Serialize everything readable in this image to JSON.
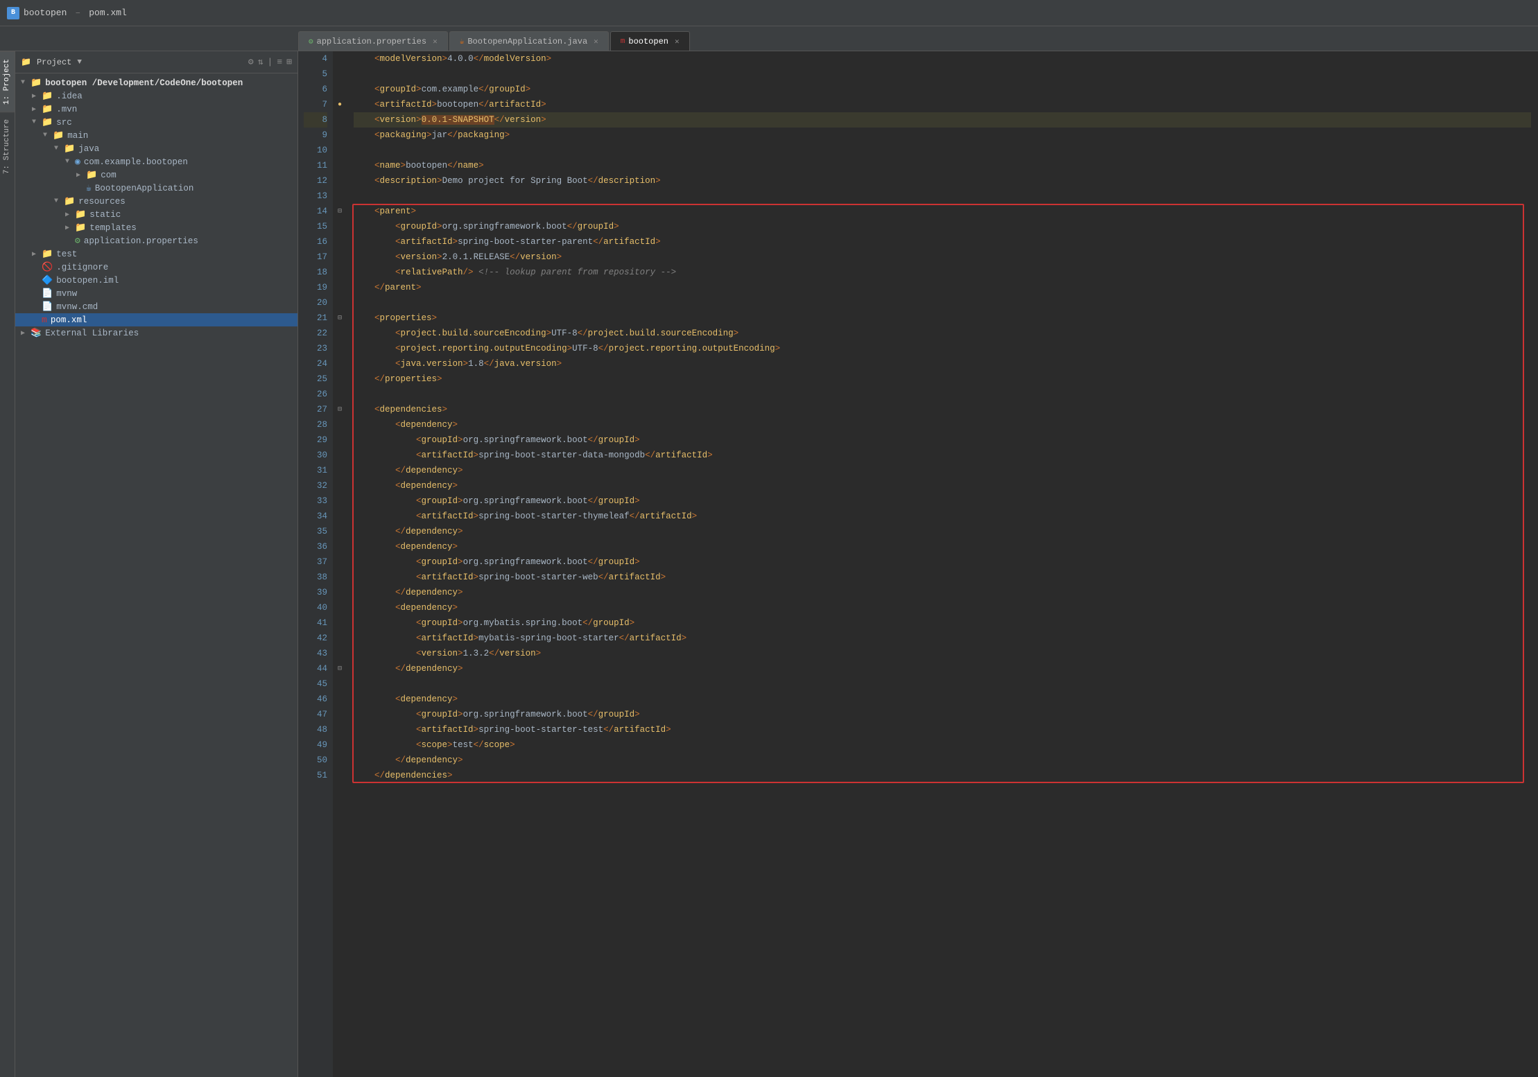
{
  "titleBar": {
    "appName": "bootopen",
    "fileName": "pom.xml",
    "logoText": "bootopen"
  },
  "tabs": [
    {
      "id": "application-properties",
      "label": "application.properties",
      "type": "props",
      "active": false
    },
    {
      "id": "bootopen-application",
      "label": "BootopenApplication.java",
      "type": "java",
      "active": false
    },
    {
      "id": "bootopen-pom",
      "label": "bootopen",
      "type": "maven",
      "active": true
    }
  ],
  "projectPanel": {
    "header": "Project",
    "dropdown": "Project"
  },
  "tree": [
    {
      "level": 0,
      "label": "bootopen /Development/CodeOne/bootopen",
      "type": "root",
      "expanded": true,
      "selected": false
    },
    {
      "level": 1,
      "label": ".idea",
      "type": "folder",
      "expanded": false,
      "selected": false
    },
    {
      "level": 1,
      "label": ".mvn",
      "type": "folder",
      "expanded": false,
      "selected": false
    },
    {
      "level": 1,
      "label": "src",
      "type": "folder",
      "expanded": true,
      "selected": false
    },
    {
      "level": 2,
      "label": "main",
      "type": "folder",
      "expanded": true,
      "selected": false
    },
    {
      "level": 3,
      "label": "java",
      "type": "folder",
      "expanded": true,
      "selected": false
    },
    {
      "level": 4,
      "label": "com.example.bootopen",
      "type": "package",
      "expanded": true,
      "selected": false
    },
    {
      "level": 5,
      "label": "com",
      "type": "folder",
      "expanded": false,
      "selected": false
    },
    {
      "level": 5,
      "label": "BootopenApplication",
      "type": "java",
      "expanded": false,
      "selected": false
    },
    {
      "level": 3,
      "label": "resources",
      "type": "folder",
      "expanded": true,
      "selected": false
    },
    {
      "level": 4,
      "label": "static",
      "type": "folder",
      "expanded": false,
      "selected": false
    },
    {
      "level": 4,
      "label": "templates",
      "type": "folder",
      "expanded": false,
      "selected": false
    },
    {
      "level": 4,
      "label": "application.properties",
      "type": "props",
      "expanded": false,
      "selected": false
    },
    {
      "level": 1,
      "label": "test",
      "type": "folder",
      "expanded": false,
      "selected": false
    },
    {
      "level": 1,
      "label": ".gitignore",
      "type": "gitignore",
      "expanded": false,
      "selected": false
    },
    {
      "level": 1,
      "label": "bootopen.iml",
      "type": "iml",
      "expanded": false,
      "selected": false
    },
    {
      "level": 1,
      "label": "mvnw",
      "type": "mvnw",
      "expanded": false,
      "selected": false
    },
    {
      "level": 1,
      "label": "mvnw.cmd",
      "type": "mvnw",
      "expanded": false,
      "selected": false
    },
    {
      "level": 1,
      "label": "pom.xml",
      "type": "xml",
      "expanded": false,
      "selected": true
    }
  ],
  "externalLibraries": {
    "label": "External Libraries",
    "expanded": false
  },
  "code": {
    "lines": [
      {
        "num": 4,
        "content": "    <modelVersion>4.0.0</modelVersion>",
        "type": "xml",
        "gutterIcon": ""
      },
      {
        "num": 5,
        "content": "",
        "type": "empty",
        "gutterIcon": ""
      },
      {
        "num": 6,
        "content": "    <groupId>com.example</groupId>",
        "type": "xml",
        "gutterIcon": ""
      },
      {
        "num": 7,
        "content": "    <artifactId>bootopen</artifactId>",
        "type": "xml",
        "gutterIcon": "yellow-dot"
      },
      {
        "num": 8,
        "content": "    <version>0.0.1-SNAPSHOT</version>",
        "type": "xml-highlight",
        "gutterIcon": ""
      },
      {
        "num": 9,
        "content": "    <packaging>jar</packaging>",
        "type": "xml",
        "gutterIcon": ""
      },
      {
        "num": 10,
        "content": "",
        "type": "empty",
        "gutterIcon": ""
      },
      {
        "num": 11,
        "content": "    <name>bootopen</name>",
        "type": "xml",
        "gutterIcon": ""
      },
      {
        "num": 12,
        "content": "    <description>Demo project for Spring Boot</description>",
        "type": "xml",
        "gutterIcon": ""
      },
      {
        "num": 13,
        "content": "",
        "type": "empty",
        "gutterIcon": ""
      },
      {
        "num": 14,
        "content": "    <parent>",
        "type": "xml-section-start",
        "gutterIcon": "fold"
      },
      {
        "num": 15,
        "content": "        <groupId>org.springframework.boot</groupId>",
        "type": "xml",
        "gutterIcon": ""
      },
      {
        "num": 16,
        "content": "        <artifactId>spring-boot-starter-parent</artifactId>",
        "type": "xml",
        "gutterIcon": ""
      },
      {
        "num": 17,
        "content": "        <version>2.0.1.RELEASE</version>",
        "type": "xml",
        "gutterIcon": ""
      },
      {
        "num": 18,
        "content": "        <relativePath/> <!-- lookup parent from repository -->",
        "type": "xml-comment",
        "gutterIcon": ""
      },
      {
        "num": 19,
        "content": "    </parent>",
        "type": "xml",
        "gutterIcon": ""
      },
      {
        "num": 20,
        "content": "",
        "type": "empty",
        "gutterIcon": ""
      },
      {
        "num": 21,
        "content": "    <properties>",
        "type": "xml-section-start",
        "gutterIcon": "fold"
      },
      {
        "num": 22,
        "content": "        <project.build.sourceEncoding>UTF-8</project.build.sourceEncoding>",
        "type": "xml",
        "gutterIcon": ""
      },
      {
        "num": 23,
        "content": "        <project.reporting.outputEncoding>UTF-8</project.reporting.outputEncoding>",
        "type": "xml",
        "gutterIcon": ""
      },
      {
        "num": 24,
        "content": "        <java.version>1.8</java.version>",
        "type": "xml",
        "gutterIcon": ""
      },
      {
        "num": 25,
        "content": "    </properties>",
        "type": "xml",
        "gutterIcon": ""
      },
      {
        "num": 26,
        "content": "",
        "type": "empty",
        "gutterIcon": ""
      },
      {
        "num": 27,
        "content": "    <dependencies>",
        "type": "xml-section-start",
        "gutterIcon": "fold"
      },
      {
        "num": 28,
        "content": "        <dependency>",
        "type": "xml",
        "gutterIcon": ""
      },
      {
        "num": 29,
        "content": "            <groupId>org.springframework.boot</groupId>",
        "type": "xml",
        "gutterIcon": ""
      },
      {
        "num": 30,
        "content": "            <artifactId>spring-boot-starter-data-mongodb</artifactId>",
        "type": "xml",
        "gutterIcon": ""
      },
      {
        "num": 31,
        "content": "        </dependency>",
        "type": "xml",
        "gutterIcon": ""
      },
      {
        "num": 32,
        "content": "        <dependency>",
        "type": "xml",
        "gutterIcon": ""
      },
      {
        "num": 33,
        "content": "            <groupId>org.springframework.boot</groupId>",
        "type": "xml",
        "gutterIcon": ""
      },
      {
        "num": 34,
        "content": "            <artifactId>spring-boot-starter-thymeleaf</artifactId>",
        "type": "xml",
        "gutterIcon": ""
      },
      {
        "num": 35,
        "content": "        </dependency>",
        "type": "xml",
        "gutterIcon": ""
      },
      {
        "num": 36,
        "content": "        <dependency>",
        "type": "xml",
        "gutterIcon": ""
      },
      {
        "num": 37,
        "content": "            <groupId>org.springframework.boot</groupId>",
        "type": "xml",
        "gutterIcon": ""
      },
      {
        "num": 38,
        "content": "            <artifactId>spring-boot-starter-web</artifactId>",
        "type": "xml",
        "gutterIcon": ""
      },
      {
        "num": 39,
        "content": "        </dependency>",
        "type": "xml",
        "gutterIcon": ""
      },
      {
        "num": 40,
        "content": "        <dependency>",
        "type": "xml",
        "gutterIcon": ""
      },
      {
        "num": 41,
        "content": "            <groupId>org.mybatis.spring.boot</groupId>",
        "type": "xml",
        "gutterIcon": ""
      },
      {
        "num": 42,
        "content": "            <artifactId>mybatis-spring-boot-starter</artifactId>",
        "type": "xml",
        "gutterIcon": ""
      },
      {
        "num": 43,
        "content": "            <version>1.3.2</version>",
        "type": "xml",
        "gutterIcon": ""
      },
      {
        "num": 44,
        "content": "        </dependency>",
        "type": "xml",
        "gutterIcon": "fold"
      },
      {
        "num": 45,
        "content": "",
        "type": "empty",
        "gutterIcon": ""
      },
      {
        "num": 46,
        "content": "        <dependency>",
        "type": "xml",
        "gutterIcon": ""
      },
      {
        "num": 47,
        "content": "            <groupId>org.springframework.boot</groupId>",
        "type": "xml",
        "gutterIcon": ""
      },
      {
        "num": 48,
        "content": "            <artifactId>spring-boot-starter-test</artifactId>",
        "type": "xml",
        "gutterIcon": ""
      },
      {
        "num": 49,
        "content": "            <scope>test</scope>",
        "type": "xml",
        "gutterIcon": ""
      },
      {
        "num": 50,
        "content": "        </dependency>",
        "type": "xml",
        "gutterIcon": ""
      },
      {
        "num": 51,
        "content": "    </dependencies>",
        "type": "xml",
        "gutterIcon": ""
      }
    ]
  },
  "sidebarTabs": [
    {
      "id": "project",
      "label": "1: Project",
      "active": true
    },
    {
      "id": "structure",
      "label": "7: Structure",
      "active": false
    }
  ]
}
